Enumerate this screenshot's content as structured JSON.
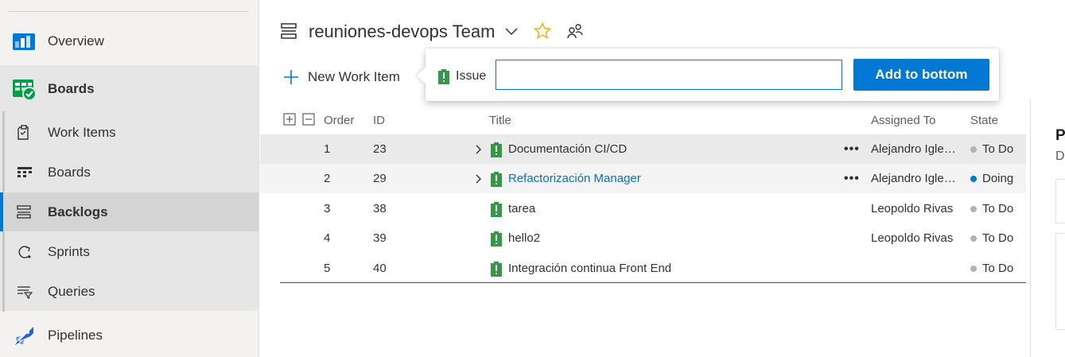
{
  "sidebar": {
    "items": {
      "overview": "Overview",
      "boards": "Boards",
      "work_items": "Work Items",
      "boards_link": "Boards",
      "backlogs": "Backlogs",
      "sprints": "Sprints",
      "queries": "Queries",
      "pipelines": "Pipelines"
    },
    "selected": "Backlogs"
  },
  "header": {
    "team_title": "reuniones-devops Team",
    "new_work_item_label": "New Work Item"
  },
  "callout": {
    "work_item_type": "Issue",
    "title_input_value": "",
    "add_button_label": "Add to bottom"
  },
  "grid": {
    "columns": {
      "order": "Order",
      "id": "ID",
      "title": "Title",
      "assigned_to": "Assigned To",
      "state": "State"
    },
    "rows": [
      {
        "order": "1",
        "id": "23",
        "title": "Documentación CI/CD",
        "assigned_to": "Alejandro Iglesias",
        "state": "To Do",
        "state_color": "#b2b2b2",
        "expandable": true,
        "has_more": true,
        "link": false
      },
      {
        "order": "2",
        "id": "29",
        "title": "Refactorización Manager",
        "assigned_to": "Alejandro Iglesias",
        "state": "Doing",
        "state_color": "#007acc",
        "expandable": true,
        "has_more": true,
        "link": true
      },
      {
        "order": "3",
        "id": "38",
        "title": "tarea",
        "assigned_to": "Leopoldo Rivas",
        "state": "To Do",
        "state_color": "#b2b2b2",
        "expandable": false,
        "has_more": false,
        "link": false
      },
      {
        "order": "4",
        "id": "39",
        "title": "hello2",
        "assigned_to": "Leopoldo Rivas",
        "state": "To Do",
        "state_color": "#b2b2b2",
        "expandable": false,
        "has_more": false,
        "link": false
      },
      {
        "order": "5",
        "id": "40",
        "title": "Integración continua Front End",
        "assigned_to": "",
        "state": "To Do",
        "state_color": "#b2b2b2",
        "expandable": false,
        "has_more": false,
        "link": false
      }
    ]
  },
  "right_panel": {
    "title_fragment": "P",
    "subtitle_fragment": "D"
  },
  "colors": {
    "accent": "#0078d4",
    "issue_icon": "#339947",
    "star": "#e8b81a"
  },
  "icons": {
    "overview": "overview-icon",
    "boards": "boards-icon",
    "work_items": "work-items-icon",
    "boards_link": "kanban-icon",
    "backlogs": "backlog-icon",
    "sprints": "sprint-icon",
    "queries": "query-icon",
    "pipelines": "pipelines-icon"
  }
}
